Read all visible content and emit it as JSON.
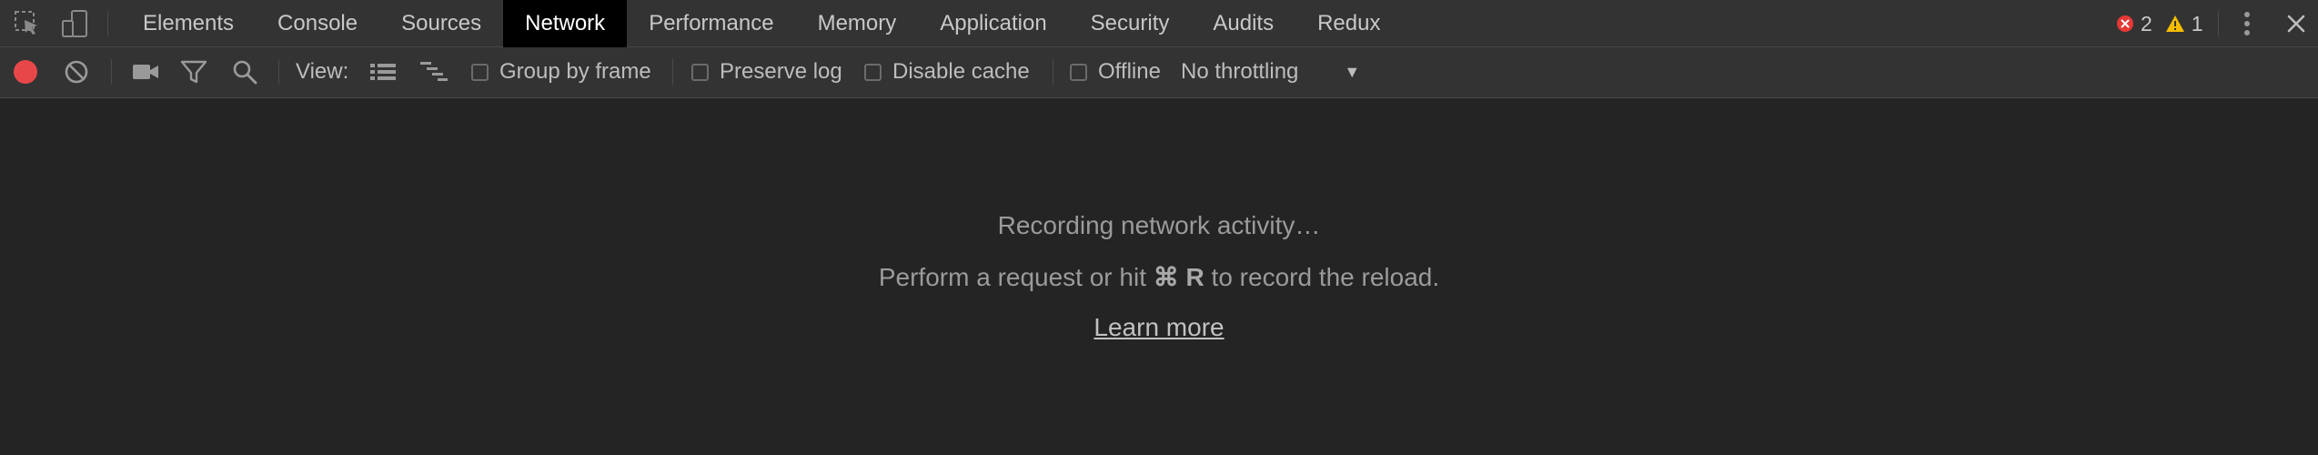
{
  "tabs": [
    {
      "label": "Elements",
      "active": false
    },
    {
      "label": "Console",
      "active": false
    },
    {
      "label": "Sources",
      "active": false
    },
    {
      "label": "Network",
      "active": true
    },
    {
      "label": "Performance",
      "active": false
    },
    {
      "label": "Memory",
      "active": false
    },
    {
      "label": "Application",
      "active": false
    },
    {
      "label": "Security",
      "active": false
    },
    {
      "label": "Audits",
      "active": false
    },
    {
      "label": "Redux",
      "active": false
    }
  ],
  "status": {
    "error_count": "2",
    "warning_count": "1",
    "error_color": "#e53935",
    "warning_color": "#f4bd00"
  },
  "toolbar": {
    "record_color": "#e8474a",
    "view_label": "View:",
    "group_by_frame": {
      "label": "Group by frame",
      "checked": false
    },
    "preserve_log": {
      "label": "Preserve log",
      "checked": false
    },
    "disable_cache": {
      "label": "Disable cache",
      "checked": false
    },
    "offline": {
      "label": "Offline",
      "checked": false
    },
    "throttling": {
      "value": "No throttling"
    }
  },
  "empty_state": {
    "title": "Recording network activity…",
    "hint_prefix": "Perform a request or hit ",
    "hint_shortcut": "⌘ R",
    "hint_suffix": " to record the reload.",
    "link": "Learn more"
  },
  "icons": {
    "inspect": "inspect-element-icon",
    "device": "device-toolbar-icon",
    "record": "record-icon",
    "clear": "clear-icon",
    "capture": "capture-screenshots-icon",
    "filter": "filter-icon",
    "search": "search-icon",
    "list_view": "large-request-rows-icon",
    "waterfall_view": "overview-icon",
    "more": "kebab-menu-icon",
    "close": "close-icon",
    "dropdown": "caret-down-icon"
  }
}
